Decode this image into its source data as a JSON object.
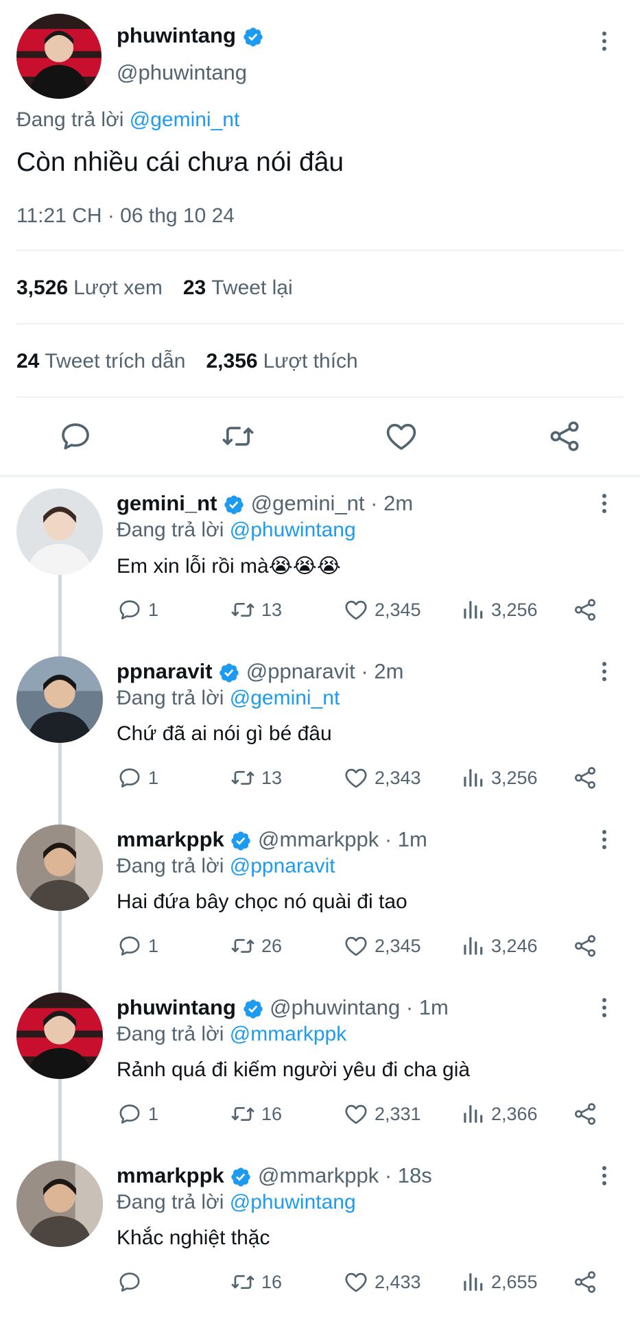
{
  "main_tweet": {
    "name": "phuwintang",
    "handle": "@phuwintang",
    "replying_prefix": "Đang trả lời",
    "replying_to": "@gemini_nt",
    "text": "Còn nhiều cái chưa nói đâu",
    "timestamp": "11:21 CH · 06 thg 10 24",
    "views_count": "3,526",
    "views_label": "Lượt xem",
    "retweets_count": "23",
    "retweets_label": "Tweet lại",
    "quotes_count": "24",
    "quotes_label": "Tweet trích dẫn",
    "likes_count": "2,356",
    "likes_label": "Lượt thích"
  },
  "replies": [
    {
      "name": "gemini_nt",
      "handle": "@gemini_nt",
      "time": "2m",
      "replying_prefix": "Đang trả lời",
      "replying_to": "@phuwintang",
      "text": "Em xin lỗi rồi mà😭😭😭",
      "replies": "1",
      "retweets": "13",
      "likes": "2,345",
      "views": "3,256"
    },
    {
      "name": "ppnaravit",
      "handle": "@ppnaravit",
      "time": "2m",
      "replying_prefix": "Đang trả lời",
      "replying_to": "@gemini_nt",
      "text": "Chứ đã ai nói gì bé đâu",
      "replies": "1",
      "retweets": "13",
      "likes": "2,343",
      "views": "3,256"
    },
    {
      "name": "mmarkppk",
      "handle": "@mmarkppk",
      "time": "1m",
      "replying_prefix": "Đang trả lời",
      "replying_to": "@ppnaravit",
      "text": "Hai đứa bây chọc nó quài đi tao",
      "replies": "1",
      "retweets": "26",
      "likes": "2,345",
      "views": "3,246"
    },
    {
      "name": "phuwintang",
      "handle": "@phuwintang",
      "time": "1m",
      "replying_prefix": "Đang trả lời",
      "replying_to": "@mmarkppk",
      "text": "Rảnh quá đi kiếm người yêu đi cha già",
      "replies": "1",
      "retweets": "16",
      "likes": "2,331",
      "views": "2,366"
    },
    {
      "name": "mmarkppk",
      "handle": "@mmarkppk",
      "time": "18s",
      "replying_prefix": "Đang trả lời",
      "replying_to": "@phuwintang",
      "text": "Khắc nghiệt thặc",
      "replies": "",
      "retweets": "16",
      "likes": "2,433",
      "views": "2,655"
    }
  ],
  "colors": {
    "accent": "#1d9bf0",
    "text_primary": "#0f1419",
    "text_secondary": "#536471",
    "divider": "#eff3f4"
  },
  "icons": [
    "verified-badge-icon",
    "more-options-icon",
    "reply-icon",
    "retweet-icon",
    "like-icon",
    "views-icon",
    "share-icon"
  ]
}
